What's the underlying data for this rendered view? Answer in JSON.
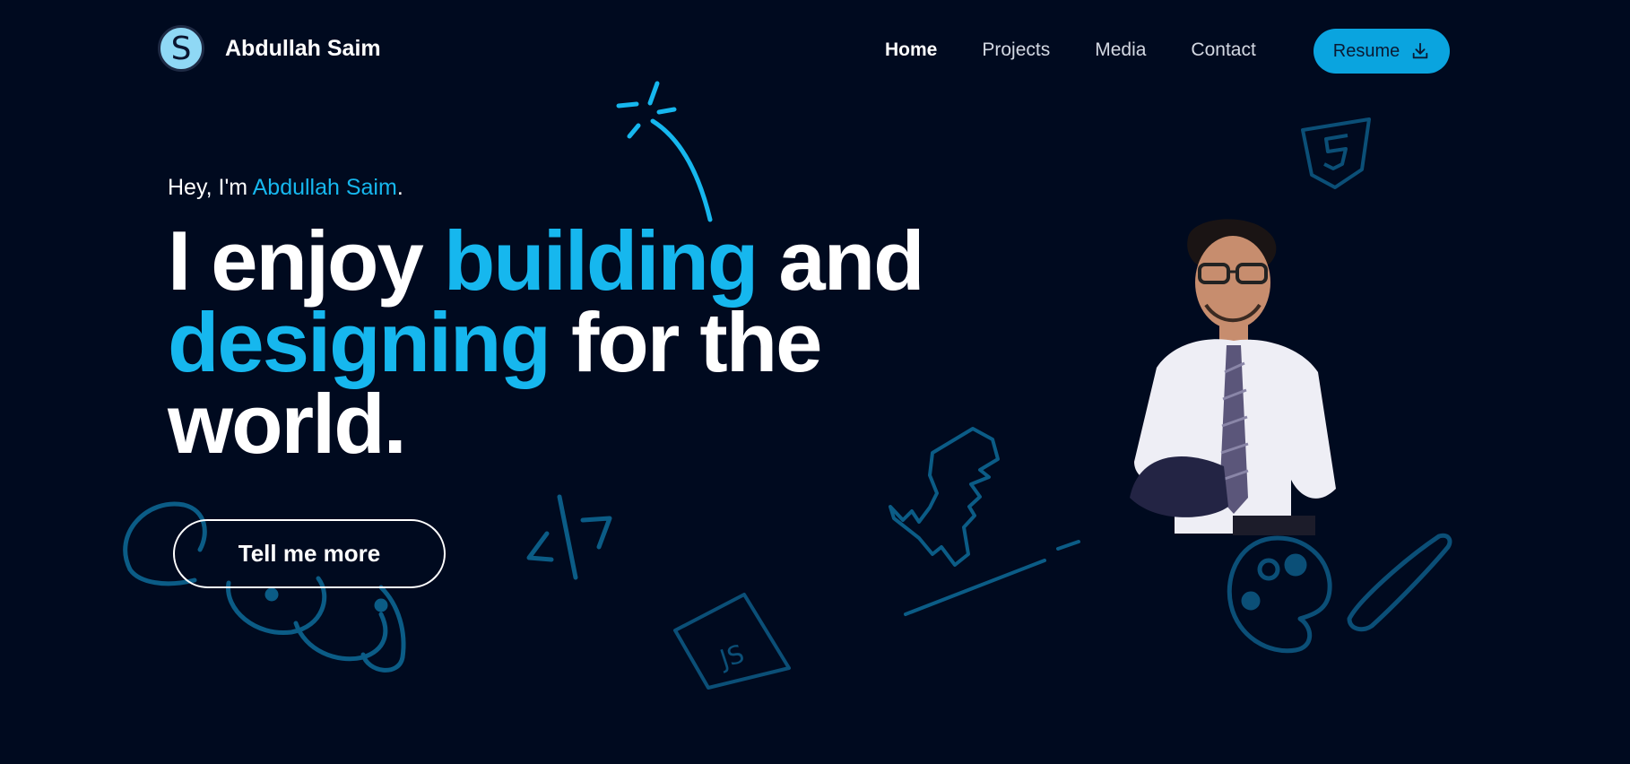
{
  "brand": {
    "name": "Abdullah Saim",
    "logo_letter": "S"
  },
  "nav": {
    "items": [
      {
        "label": "Home",
        "active": true
      },
      {
        "label": "Projects",
        "active": false
      },
      {
        "label": "Media",
        "active": false
      },
      {
        "label": "Contact",
        "active": false
      }
    ],
    "resume_label": "Resume",
    "resume_icon": "download-icon"
  },
  "hero": {
    "greeting_prefix": "Hey, I'm ",
    "greeting_name": "Abdullah Saim",
    "greeting_suffix": ".",
    "headline": {
      "part1": "I enjoy ",
      "accent1": "building",
      "part2": " and ",
      "accent2": "designing",
      "part3": " for the world."
    },
    "cta_label": "Tell me more"
  },
  "doodles": {
    "js_badge_text": "JS",
    "code_tag_text": "</>"
  },
  "colors": {
    "background": "#000a1f",
    "accent": "#16b7ee",
    "doodle": "#0b5c86",
    "button": "#0aa4df"
  }
}
